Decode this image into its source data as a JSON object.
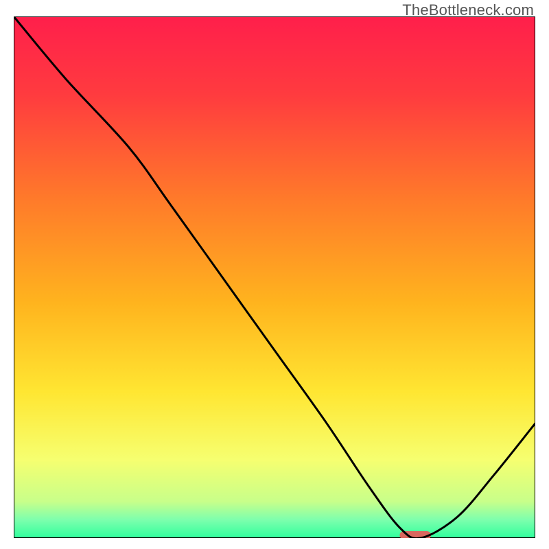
{
  "watermark": "TheBottleneck.com",
  "chart_data": {
    "type": "line",
    "title": "",
    "xlabel": "",
    "ylabel": "",
    "xlim": [
      0,
      100
    ],
    "ylim": [
      0,
      100
    ],
    "grid": false,
    "legend": null,
    "annotations": [],
    "series": [
      {
        "name": "bottleneck-curve",
        "x": [
          0,
          10,
          22,
          30,
          40,
          50,
          60,
          68,
          74,
          78,
          85,
          92,
          100
        ],
        "y": [
          100,
          88,
          75,
          64,
          50,
          36,
          22,
          10,
          2,
          0,
          4,
          12,
          22
        ]
      }
    ],
    "optimal_marker": {
      "x_start": 74,
      "x_end": 80,
      "y": 0
    },
    "background_gradient": {
      "stops": [
        {
          "offset": 0.0,
          "color": "#ff1f4b"
        },
        {
          "offset": 0.15,
          "color": "#ff3b3f"
        },
        {
          "offset": 0.35,
          "color": "#ff7a2a"
        },
        {
          "offset": 0.55,
          "color": "#ffb41e"
        },
        {
          "offset": 0.72,
          "color": "#ffe632"
        },
        {
          "offset": 0.85,
          "color": "#f6ff70"
        },
        {
          "offset": 0.93,
          "color": "#c8ff8a"
        },
        {
          "offset": 0.965,
          "color": "#7dffad"
        },
        {
          "offset": 1.0,
          "color": "#2fff9d"
        }
      ]
    },
    "marker_color": "#d9675f",
    "curve_color": "#000000",
    "border_color": "#000000"
  }
}
